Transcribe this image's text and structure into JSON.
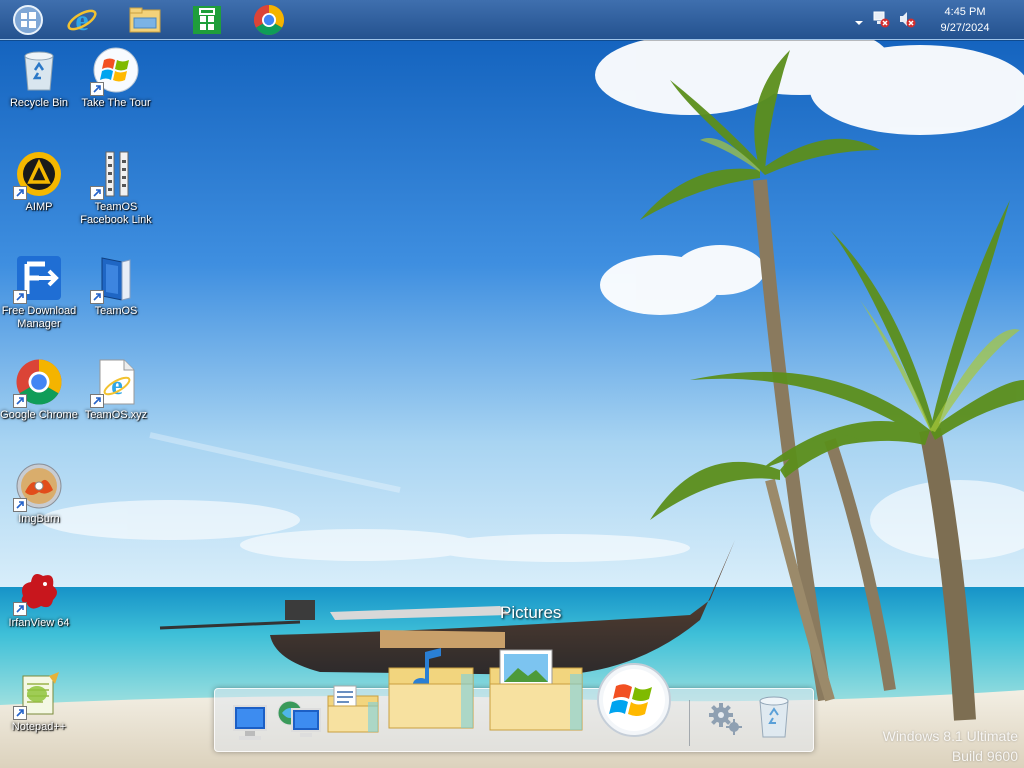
{
  "taskbar": {
    "pinned": [
      {
        "name": "start-icon"
      },
      {
        "name": "internet-explorer-icon"
      },
      {
        "name": "file-explorer-icon"
      },
      {
        "name": "windows-store-icon"
      },
      {
        "name": "google-chrome-icon"
      }
    ],
    "tray": {
      "icons": [
        "show-hidden-icons-chevron-icon",
        "network-disconnected-icon",
        "volume-muted-icon"
      ],
      "time": "4:45 PM",
      "date": "9/27/2024"
    }
  },
  "desktop": {
    "icons": [
      {
        "label": "Recycle Bin",
        "icon": "recycle-bin-icon"
      },
      {
        "label": "Take The Tour",
        "icon": "windows-logo-icon"
      },
      {
        "label": "AIMP",
        "icon": "aimp-icon"
      },
      {
        "label": "TeamOS Facebook Link",
        "icon": "zipper-file-icon"
      },
      {
        "label": "Free Download Manager",
        "icon": "fdm-icon"
      },
      {
        "label": "TeamOS",
        "icon": "book-icon"
      },
      {
        "label": "Google Chrome",
        "icon": "chrome-icon"
      },
      {
        "label": "TeamOS.xyz",
        "icon": "ie-document-icon"
      },
      {
        "label": "ImgBurn",
        "icon": "imgburn-disc-icon"
      },
      {
        "label": "IrfanView 64",
        "icon": "irfanview-icon"
      },
      {
        "label": "Notepad++",
        "icon": "notepad-plus-plus-icon"
      }
    ]
  },
  "dock": {
    "hover_label": "Pictures",
    "items": [
      "computer-icon",
      "network-icon",
      "documents-folder-icon",
      "music-folder-icon",
      "pictures-folder-icon",
      "start-orb-icon",
      "settings-gear-icon",
      "recycle-bin-glass-icon"
    ]
  },
  "watermark": {
    "line1": "Windows 8.1 Ultimate",
    "line2": "Build 9600"
  }
}
